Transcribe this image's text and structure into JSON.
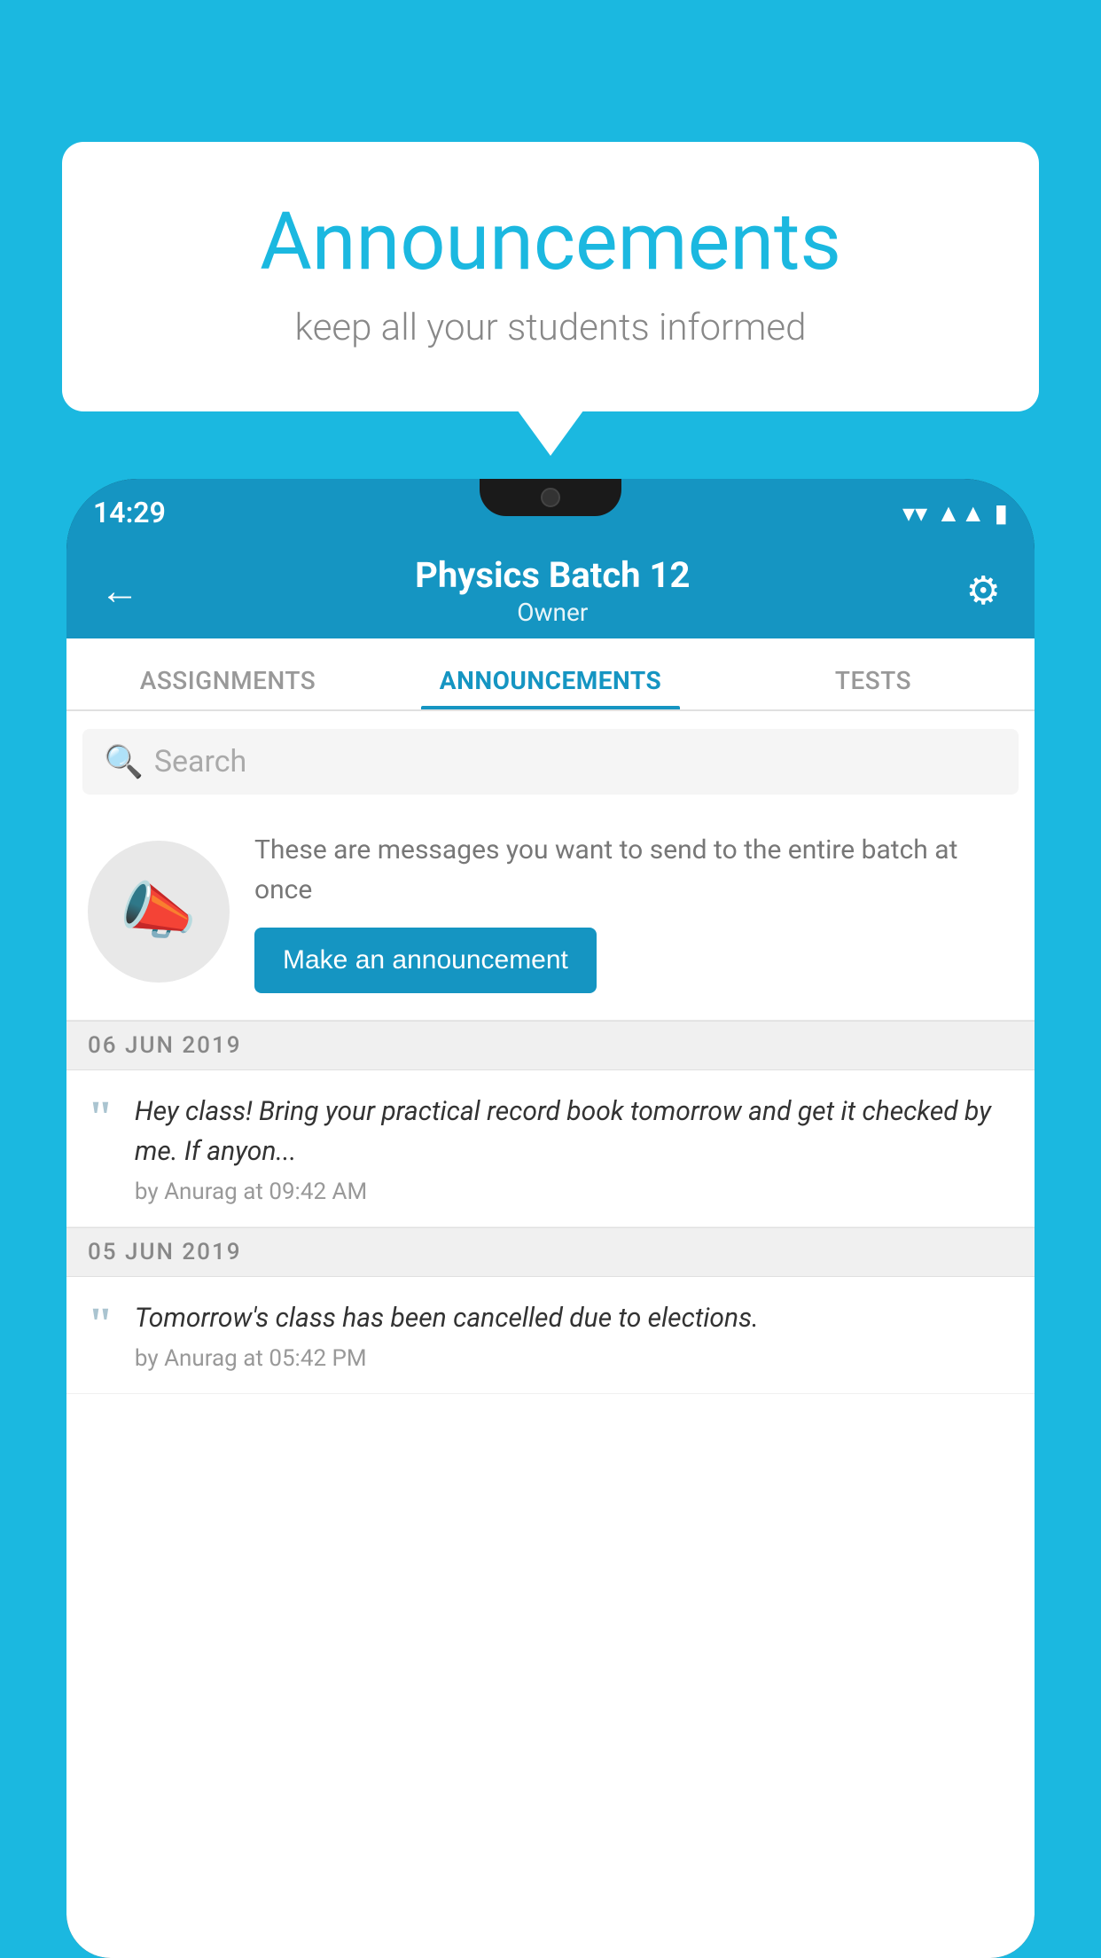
{
  "background_color": "#1bb8e0",
  "announcement_card": {
    "title": "Announcements",
    "subtitle": "keep all your students informed"
  },
  "phone": {
    "status_bar": {
      "time": "14:29"
    },
    "header": {
      "title": "Physics Batch 12",
      "subtitle": "Owner",
      "back_label": "←",
      "gear_label": "⚙"
    },
    "tabs": [
      {
        "label": "ASSIGNMENTS",
        "active": false
      },
      {
        "label": "ANNOUNCEMENTS",
        "active": true
      },
      {
        "label": "TESTS",
        "active": false
      }
    ],
    "search": {
      "placeholder": "Search"
    },
    "promo": {
      "description": "These are messages you want to send to the entire batch at once",
      "button_label": "Make an announcement"
    },
    "announcements": [
      {
        "date": "06  JUN  2019",
        "items": [
          {
            "message": "Hey class! Bring your practical record book tomorrow and get it checked by me. If anyon...",
            "author": "by Anurag at 09:42 AM"
          }
        ]
      },
      {
        "date": "05  JUN  2019",
        "items": [
          {
            "message": "Tomorrow's class has been cancelled due to elections.",
            "author": "by Anurag at 05:42 PM"
          }
        ]
      }
    ]
  }
}
